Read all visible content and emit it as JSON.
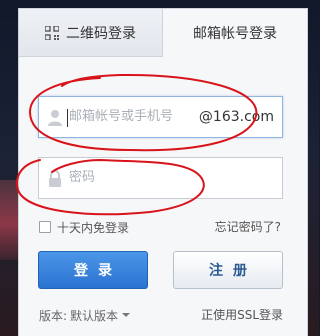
{
  "tabs": {
    "qr_label": "二维码登录",
    "mail_label": "邮箱帐号登录"
  },
  "username": {
    "placeholder": "邮箱帐号或手机号",
    "suffix": "@163.com",
    "icon": "user-icon"
  },
  "password": {
    "placeholder": "密码",
    "icon": "lock-icon"
  },
  "options": {
    "remember_label": "十天内免登录",
    "remember_checked": false,
    "forgot_label": "忘记密码了?"
  },
  "buttons": {
    "login_label": "登录",
    "register_label": "注册"
  },
  "footer": {
    "version_label": "版本:",
    "version_value": "默认版本",
    "ssl_label": "正使用SSL登录"
  },
  "colors": {
    "primary": "#2a73d0",
    "annotation": "#d8141a"
  }
}
